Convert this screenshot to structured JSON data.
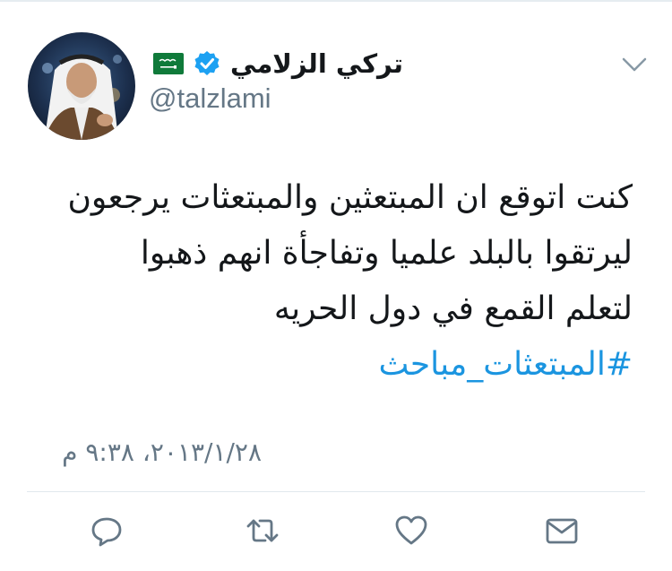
{
  "tweet": {
    "author": {
      "display_name": "تركي الزلامي",
      "handle": "@talzlami",
      "verified": true,
      "flag": "saudi-arabia-flag"
    },
    "text_lines": [
      "كنت اتوقع ان المبتعثين والمبتعثات يرجعون",
      "ليرتقوا بالبلد علميا وتفاجأة انهم ذهبوا",
      "لتعلم القمع في دول الحريه"
    ],
    "hashtag": "#المبتعثات_مباحث",
    "timestamp": "٢٠١٣/١/٢٨، ٩:٣٨ م"
  },
  "icons": {
    "menu": "chevron-down-icon",
    "reply": "reply-icon",
    "retweet": "retweet-icon",
    "like": "heart-icon",
    "message": "envelope-icon"
  },
  "colors": {
    "text": "#14171a",
    "secondary": "#657786",
    "link": "#1b95e0",
    "verified": "#1da1f2",
    "icon": "#657786",
    "divider": "#e1e8ed"
  }
}
